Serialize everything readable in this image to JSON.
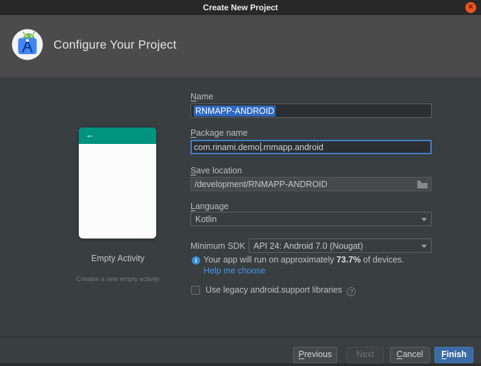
{
  "window": {
    "title": "Create New Project"
  },
  "icons": {
    "close": "✕",
    "back_arrow": "←",
    "info": "i",
    "help": "?"
  },
  "header": {
    "title": "Configure Your Project"
  },
  "template": {
    "name": "Empty Activity",
    "description": "Creates a new empty activity"
  },
  "form": {
    "name": {
      "mn": "N",
      "rest": "ame",
      "value": "RNMAPP-ANDROID"
    },
    "package_name": {
      "mn": "P",
      "rest": "ackage name",
      "value_before_caret": "com.rinami.demo",
      "value_after_caret": ".rnmapp.android"
    },
    "save_location": {
      "mn": "S",
      "rest": "ave location",
      "value": "/development/RNMAPP-ANDROID"
    },
    "language": {
      "mn": "L",
      "rest": "anguage",
      "value": "Kotlin"
    },
    "min_sdk": {
      "label": "Minimum SDK",
      "value": "API 24: Android 7.0 (Nougat)"
    },
    "sdk_info": {
      "prefix": "Your app will run on approximately ",
      "highlight": "73.7%",
      "suffix": " of devices."
    },
    "help_link": "Help me choose",
    "legacy_checkbox": {
      "label": "Use legacy android.support libraries",
      "checked": false
    }
  },
  "footer": {
    "previous": {
      "mn": "P",
      "rest": "revious"
    },
    "next": {
      "label": "Next"
    },
    "cancel": {
      "mn": "C",
      "rest": "ancel"
    },
    "finish": {
      "mn": "F",
      "rest": "inish"
    }
  },
  "colors": {
    "titlebar": "#282828",
    "header_bg": "#4b4b4b",
    "panel_bg": "#393e41",
    "accent_blue": "#3b6ba5",
    "selection_blue": "#3069c0",
    "focus_border": "#4681c8",
    "teal": "#00937e",
    "link_blue": "#4596e8",
    "close_red": "#e9541f"
  }
}
